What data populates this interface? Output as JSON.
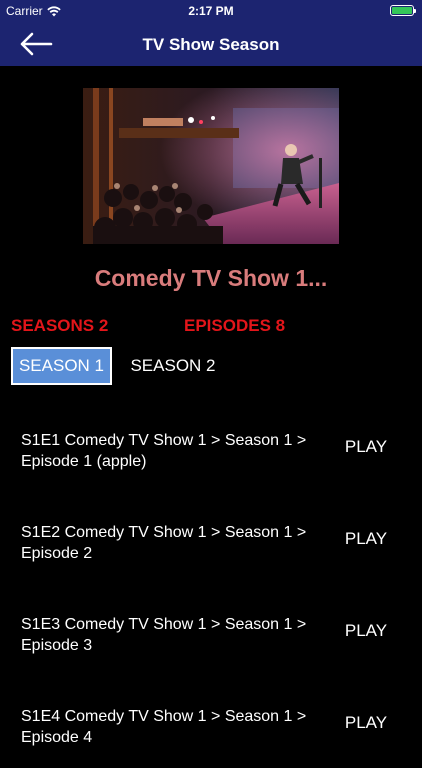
{
  "status_bar": {
    "carrier": "Carrier",
    "time": "2:17 PM",
    "battery_color": "#34c759"
  },
  "nav": {
    "title": "TV Show Season",
    "back_icon": "arrow-left-icon",
    "background": "#1c2470"
  },
  "show": {
    "image": "comedy-stage-photo",
    "title": "Comedy TV Show 1..."
  },
  "counts": {
    "seasons": "SEASONS 2",
    "episodes": "EPISODES 8",
    "color": "#e3151a"
  },
  "season_tabs": [
    {
      "label": "SEASON 1",
      "selected": true
    },
    {
      "label": "SEASON 2",
      "selected": false
    }
  ],
  "episodes": [
    {
      "title": "S1E1 Comedy TV Show 1 > Season 1 > Episode 1 (apple)",
      "action": "PLAY"
    },
    {
      "title": "S1E2 Comedy TV Show 1 > Season 1 > Episode 2",
      "action": "PLAY"
    },
    {
      "title": "S1E3 Comedy TV Show 1 > Season 1 > Episode 3",
      "action": "PLAY"
    },
    {
      "title": "S1E4 Comedy TV Show 1 > Season 1 > Episode 4",
      "action": "PLAY"
    }
  ]
}
